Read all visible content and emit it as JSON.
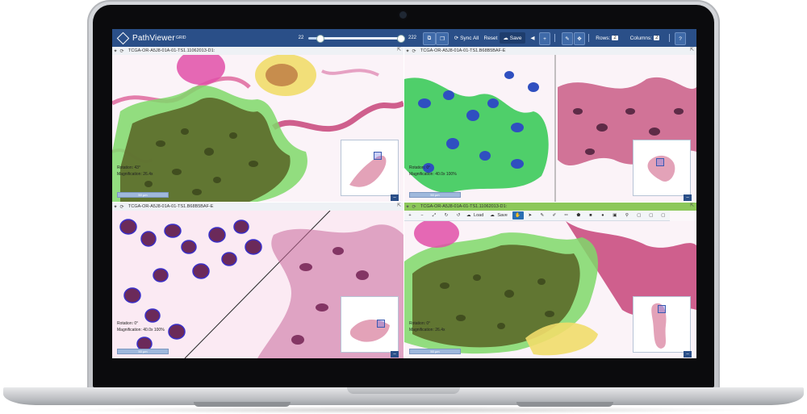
{
  "app": {
    "brand": "PathViewer",
    "brand_sup": "GRID",
    "accent": "#2a4f88"
  },
  "toolbar": {
    "slider_min": "22",
    "slider_max": "222",
    "sync_label": "Sync All",
    "reset_label": "Reset",
    "save_label": "Save",
    "rows_label": "Rows:",
    "rows_value": "2",
    "columns_label": "Columns:",
    "columns_value": "2",
    "help_label": "?"
  },
  "panes": [
    {
      "title": "TCGA-OR-A5J8-01A-01-TS1.11062013-D1:",
      "rotation_label": "Rotation:",
      "rotation_value": "43°",
      "mag_label": "Magnification:",
      "mag_value": "26.4x",
      "scale_label": "50 µm"
    },
    {
      "title": "TCGA-OR-A5J8-01A-01-TS1.B68B5BAF-E",
      "rotation_label": "Rotation:",
      "rotation_value": "0°",
      "mag_label": "Magnification:",
      "mag_value": "40.0x 100%",
      "scale_label": "50 µm"
    },
    {
      "title": "TCGA-OR-A5J8-01A-01-TS1.B68B5BAF-E",
      "rotation_label": "Rotation:",
      "rotation_value": "0°",
      "mag_label": "Magnification:",
      "mag_value": "40.0x 100%",
      "scale_label": "50 µm"
    },
    {
      "title": "TCGA-OR-A5J8-01A-01-TS1.11062013-D1:",
      "rotation_label": "Rotation:",
      "rotation_value": "0°",
      "mag_label": "Magnification:",
      "mag_value": "26.4x",
      "scale_label": "50 µm"
    }
  ],
  "annotation_toolbar": {
    "load_label": "Load",
    "save_label": "Save"
  },
  "colors": {
    "tumor_mask": "#6fd06a",
    "nucleus": "#3a55c8",
    "stain": "#c03a78",
    "lumen": "#e6c63a"
  }
}
